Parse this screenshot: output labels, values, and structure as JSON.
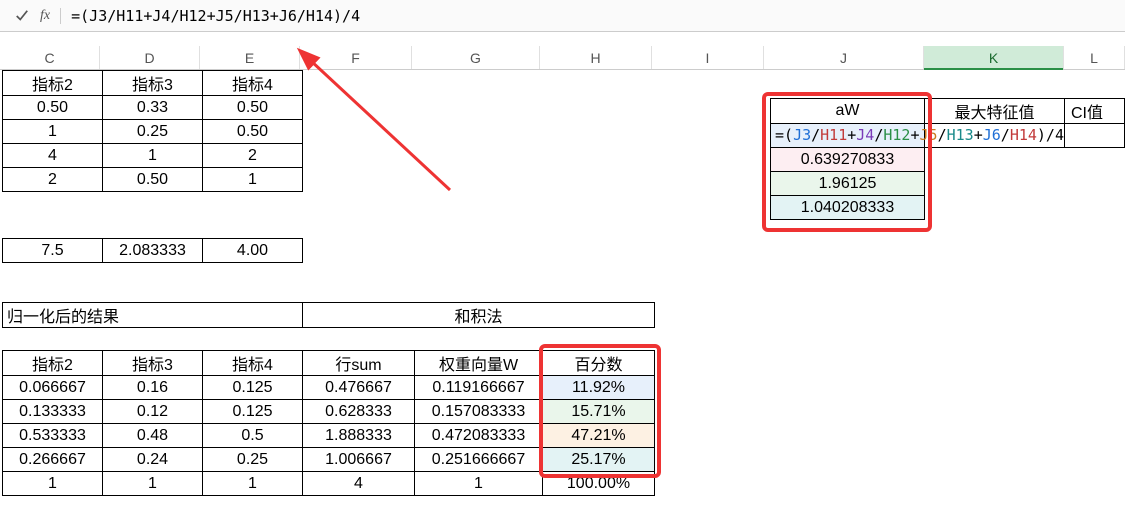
{
  "formula_bar": {
    "fx": "fx",
    "formula_plain": "=(J3/H11+J4/H12+J5/H13+J6/H14)/4"
  },
  "columns": [
    "C",
    "D",
    "E",
    "F",
    "G",
    "H",
    "I",
    "J",
    "K",
    "L"
  ],
  "active_column": "K",
  "top_table": {
    "headers": [
      "指标2",
      "指标3",
      "指标4"
    ],
    "rows": [
      [
        "0.50",
        "0.33",
        "0.50"
      ],
      [
        "1",
        "0.25",
        "0.50"
      ],
      [
        "4",
        "1",
        "2"
      ],
      [
        "2",
        "0.50",
        "1"
      ]
    ],
    "sums": [
      "7.5",
      "2.083333",
      "4.00"
    ]
  },
  "norm_label": "归一化后的结果",
  "sum_method_label": "和积法",
  "bottom_table": {
    "headers": [
      "指标2",
      "指标3",
      "指标4",
      "行sum",
      "权重向量W",
      "百分数"
    ],
    "rows": [
      [
        "0.066667",
        "0.16",
        "0.125",
        "0.476667",
        "0.119166667",
        "11.92%"
      ],
      [
        "0.133333",
        "0.12",
        "0.125",
        "0.628333",
        "0.157083333",
        "15.71%"
      ],
      [
        "0.533333",
        "0.48",
        "0.5",
        "1.888333",
        "0.472083333",
        "47.21%"
      ],
      [
        "0.266667",
        "0.24",
        "0.25",
        "1.006667",
        "0.251666667",
        "25.17%"
      ],
      [
        "1",
        "1",
        "1",
        "4",
        "1",
        "100.00%"
      ]
    ]
  },
  "aw_block": {
    "header": "aW",
    "other_headers": [
      "最大特征值",
      "CI值"
    ],
    "formula_parts": {
      "eq": "=(",
      "j3": "J3",
      "sl1": "/",
      "h11": "H11",
      "pl1": "+",
      "j4": "J4",
      "sl2": "/",
      "h12": "H12",
      "pl2": "+",
      "j5": "J5",
      "sl3": "/",
      "h13": "H13",
      "pl3": "+",
      "j6": "J6",
      "sl4": "/",
      "h14": "H14",
      "tail": ")/4"
    },
    "values": [
      "0.639270833",
      "1.96125",
      "1.040208333"
    ]
  },
  "chart_data": {
    "type": "table",
    "note": "Screenshot is a spreadsheet, not a chart; data captured in top_table, bottom_table, aw_block."
  }
}
